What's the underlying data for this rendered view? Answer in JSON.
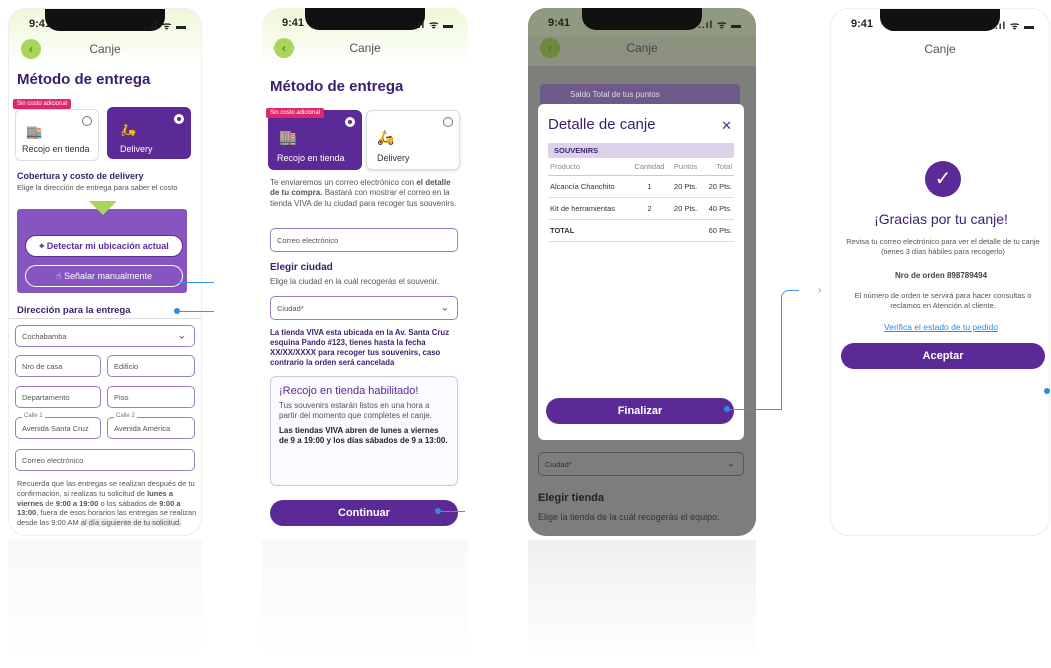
{
  "common": {
    "time": "9:41",
    "nav_title": "Canje",
    "back_glyph": "‹",
    "signals": "..ıl ᯤ ▬"
  },
  "screen1": {
    "title": "Método de entrega",
    "tag": "Sin costo adicional",
    "option_store": "Recojo en tienda",
    "option_delivery": "Delivery",
    "coverage_title": "Cobertura y costo de delivery",
    "coverage_sub": "Elige la dirección de entrega para saber el costo",
    "detect_btn": "Detectar mi ubicación actual",
    "manual_btn": "Señalar manualmente",
    "address_title": "Dirección para la entrega",
    "city_value": "Cochabamba",
    "house_placeholder": "Nro de casa",
    "building_placeholder": "Edificio",
    "dept_placeholder": "Departamento",
    "floor_placeholder": "Piso",
    "street1_label": "Calle 1",
    "street1_value": "Avenida Santa Cruz",
    "street2_label": "Calle 2",
    "street2_value": "Avenida América",
    "email_placeholder": "Correo electrónico",
    "note_a": "Recuerda que las entregas se realizan después de tu confirmación, si realizas tu solicitud de",
    "note_b": "lunes a viernes",
    "note_c": "de",
    "note_d": "9:00 a 19:00",
    "note_e": "o los sábados de",
    "note_f": "9:00 a 13:00",
    "note_g": ", fuera de esos horarios las entregas se realizan desde las 9:00 AM",
    "note_h": "al día siguiente de tu solicitud."
  },
  "screen2": {
    "title": "Método de entrega",
    "tag": "Sin costo adicional",
    "option_store": "Recojo en tienda",
    "option_delivery": "Delivery",
    "intro_a": "Te enviaremos un correo electrónico con",
    "intro_b": "el detalle de tu compra.",
    "intro_c": "Bastará con mostrar el correo en la tienda VIVA de tu ciudad para recoger tus souvenirs.",
    "email_placeholder": "Correo electrónico",
    "city_title": "Elegir ciudad",
    "city_sub": "Elige la ciudad en la cuál recogerás el souvenir.",
    "city_placeholder": "Ciudad*",
    "store_info": "La tienda VIVA esta ubicada en la Av. Santa Cruz esquina Pando #123, tienes hasta la fecha XX/XX/XXXX para recoger tus souvenirs, caso contrario la orden será cancelada",
    "box_title": "¡Recojo en tienda habilitado!",
    "box_text": "Tus souvenirs estarán listos en una hora a partir del momento que completes el canje.",
    "box_bold": "Las tiendas VIVA abren de lunes a viernes de 9 a 19:00 y los días sábados de 9 a 13:00.",
    "continue_btn": "Continuar"
  },
  "screen3": {
    "balance_label": "Saldo Total de tus puntos",
    "modal_title": "Detalle de canje",
    "close_glyph": "✕",
    "section": "SOUVENIRS",
    "headers": [
      "Producto",
      "Cantidad",
      "Puntos",
      "Total"
    ],
    "rows": [
      [
        "Alcancía Chanchito",
        "1",
        "20 Pts.",
        "20 Pts."
      ],
      [
        "Kit de herramientas",
        "2",
        "20 Pts.",
        "40 Pts."
      ]
    ],
    "total_label": "TOTAL",
    "total_value": "60 Pts.",
    "finish_btn": "Finalizar",
    "city_placeholder": "Ciudad*",
    "store_title": "Elegir tienda",
    "store_sub": "Elige la tienda de la cuál recogerás el equipo."
  },
  "screen4": {
    "thanks": "¡Gracias por tu canje!",
    "sub": "Revisa tu correo electrónico para ver el detalle de tu canje (tienes 3 días hábiles para recogerlo)",
    "order": "Nro de orden 898789494",
    "info": "El número de orden te servirá para hacer consultas o reclamos en Atención al cliente.",
    "link": "Verifica el estado de tu pedido",
    "accept_btn": "Aceptar"
  },
  "colors": {
    "primary": "#5b2a96",
    "accent_green": "#a7d65a",
    "tag_pink": "#e0266e",
    "link_blue": "#2b8ce0"
  }
}
